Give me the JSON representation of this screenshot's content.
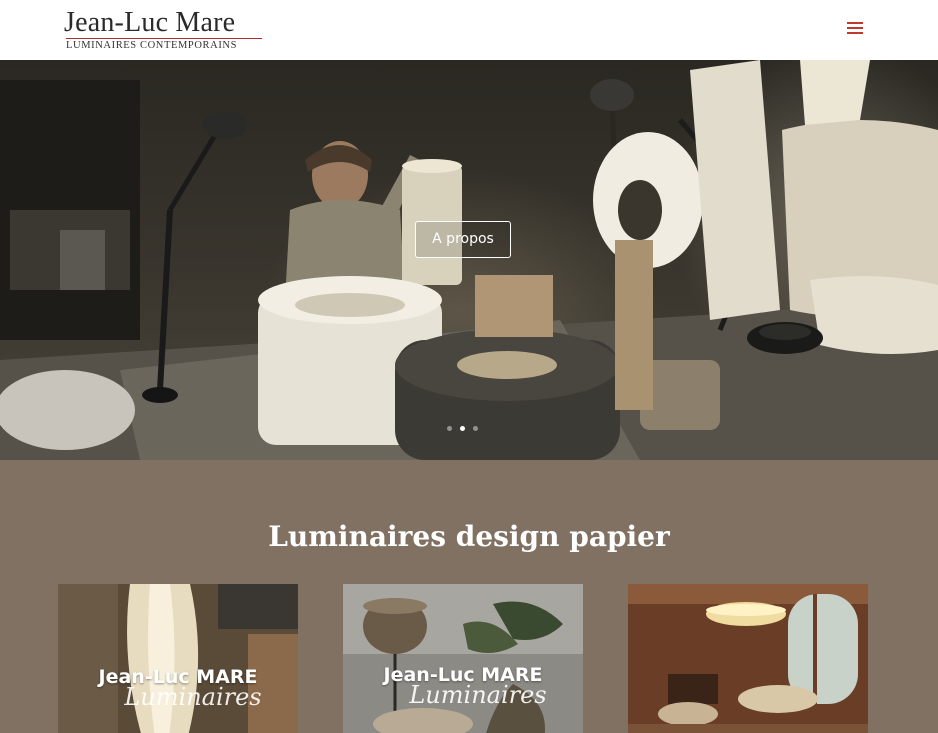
{
  "header": {
    "logo_name": "Jean-Luc Mare",
    "logo_tagline": "LUMINAIRES CONTEMPORAINS",
    "menu_icon": "hamburger-menu-icon",
    "accent_color": "#c0392b"
  },
  "hero": {
    "button_label": "A propos",
    "slide_count": 3,
    "active_slide": 2
  },
  "section": {
    "title": "Luminaires design papier",
    "background_color": "#807163",
    "cards": [
      {
        "brand": "Jean-Luc MARE",
        "script": "Luminaires"
      },
      {
        "brand": "Jean-Luc MARE",
        "script": "Luminaires"
      },
      {
        "brand": "",
        "script": ""
      }
    ]
  }
}
